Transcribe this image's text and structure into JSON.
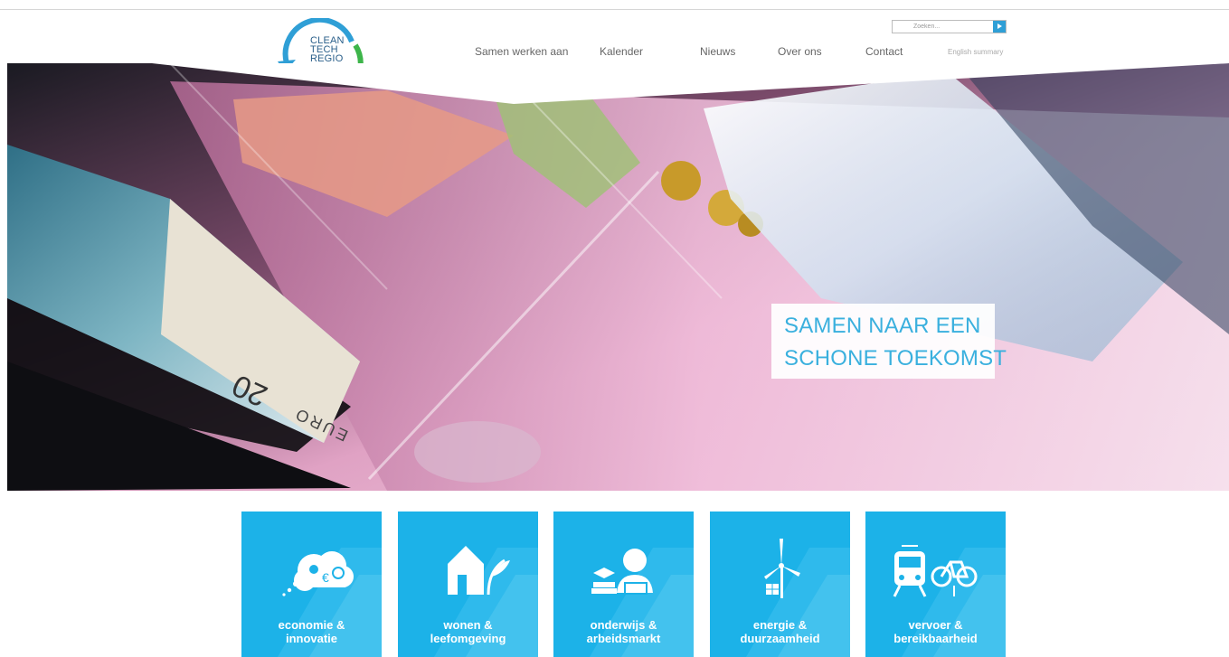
{
  "logo": {
    "lines": [
      "CLEAN",
      "TECH",
      "REGIO"
    ],
    "icon": "recycle-arrows-logo",
    "colors": {
      "arrow_green": "#3db54a",
      "arrow_blue": "#2f9fd6",
      "text": "#2a5f8a"
    }
  },
  "search": {
    "placeholder": "Zoeken...",
    "button_icon": "play-arrow-icon"
  },
  "nav": {
    "items": [
      "Samen werken aan",
      "Kalender",
      "Nieuws",
      "Over ons",
      "Contact"
    ],
    "english": "English summary"
  },
  "hero": {
    "line1": "SAMEN NAAR EEN",
    "line2": "SCHONE TOEKOMST",
    "image": "cash-drawer-with-euro-notes",
    "banknote_text": "20 EURO",
    "accent_color": "#3ab0de"
  },
  "tiles": [
    {
      "line1": "economie &",
      "line2": "innovatie",
      "icon": "idea-cloud-icon"
    },
    {
      "line1": "wonen &",
      "line2": "leefomgeving",
      "icon": "house-plant-icon"
    },
    {
      "line1": "onderwijs &",
      "line2": "arbeidsmarkt",
      "icon": "student-books-icon"
    },
    {
      "line1": "energie &",
      "line2": "duurzaamheid",
      "icon": "wind-solar-icon"
    },
    {
      "line1": "vervoer &",
      "line2": "bereikbaarheid",
      "icon": "train-bike-icon"
    }
  ],
  "tile_color": "#1cb2e8"
}
